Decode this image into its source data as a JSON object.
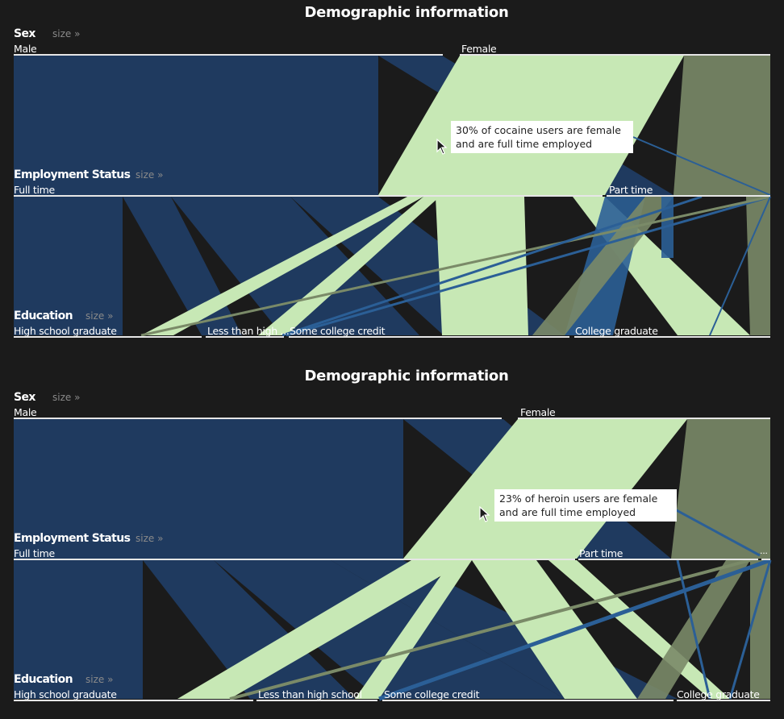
{
  "colors": {
    "background": "#1b1b1b",
    "male": "#1f3a5f",
    "male_light": "#2b5f96",
    "female": "#c7e8b5",
    "female_muted": "#7a8a68",
    "line": "#e6e6e6"
  },
  "panels": [
    {
      "title": "Demographic information",
      "dimensions": [
        {
          "name": "Sex",
          "size_link": "size »",
          "categories": [
            "Male",
            "Female"
          ]
        },
        {
          "name": "Employment Status",
          "size_link": "size »",
          "categories": [
            "Full time",
            "Part time"
          ]
        },
        {
          "name": "Education",
          "size_link": "size »",
          "categories": [
            "High school graduate",
            "Less than high ...",
            "Some college credit",
            "College graduate"
          ]
        }
      ],
      "tooltip": "30% of cocaine users are female and are full time employed",
      "cursor_icon": "arrow-cursor-icon"
    },
    {
      "title": "Demographic information",
      "dimensions": [
        {
          "name": "Sex",
          "size_link": "size »",
          "categories": [
            "Male",
            "Female"
          ]
        },
        {
          "name": "Employment Status",
          "size_link": "size »",
          "categories": [
            "Full time",
            "Part time",
            "..."
          ]
        },
        {
          "name": "Education",
          "size_link": "size »",
          "categories": [
            "High school graduate",
            "Less than high school",
            "Some college credit",
            "College graduate"
          ]
        }
      ],
      "tooltip": "23% of heroin users are female and are full time employed",
      "cursor_icon": "arrow-cursor-icon"
    }
  ],
  "chart_data": [
    {
      "type": "parallel-sets",
      "title": "Demographic information",
      "dimensions": [
        "Sex",
        "Employment Status",
        "Education"
      ],
      "axes": {
        "Sex": {
          "Male": 0.57,
          "Female": 0.43
        },
        "Employment Status": {
          "Full time": 0.79,
          "Part time": 0.21
        },
        "Education": {
          "High school graduate": 0.25,
          "Less than high ...": 0.11,
          "Some college credit": 0.37,
          "College graduate": 0.27
        }
      },
      "flows_sex_employment": [
        {
          "sex": "Male",
          "employment": "Full time",
          "share": 0.49
        },
        {
          "sex": "Male",
          "employment": "Part time",
          "share": 0.08
        },
        {
          "sex": "Female",
          "employment": "Full time",
          "share": 0.3
        },
        {
          "sex": "Female",
          "employment": "Part time",
          "share": 0.13
        }
      ],
      "annotation": "30% of cocaine users are female and are full time employed"
    },
    {
      "type": "parallel-sets",
      "title": "Demographic information",
      "dimensions": [
        "Sex",
        "Employment Status",
        "Education"
      ],
      "axes": {
        "Sex": {
          "Male": 0.65,
          "Female": 0.35
        },
        "Employment Status": {
          "Full time": 0.74,
          "Part time": 0.25,
          "...": 0.01
        },
        "Education": {
          "High school graduate": 0.32,
          "Less than high school": 0.16,
          "Some college credit": 0.39,
          "College graduate": 0.13
        }
      },
      "flows_sex_employment": [
        {
          "sex": "Male",
          "employment": "Full time",
          "share": 0.51
        },
        {
          "sex": "Male",
          "employment": "Part time",
          "share": 0.14
        },
        {
          "sex": "Female",
          "employment": "Full time",
          "share": 0.23
        },
        {
          "sex": "Female",
          "employment": "Part time",
          "share": 0.12
        }
      ],
      "annotation": "23% of heroin users are female and are full time employed"
    }
  ]
}
